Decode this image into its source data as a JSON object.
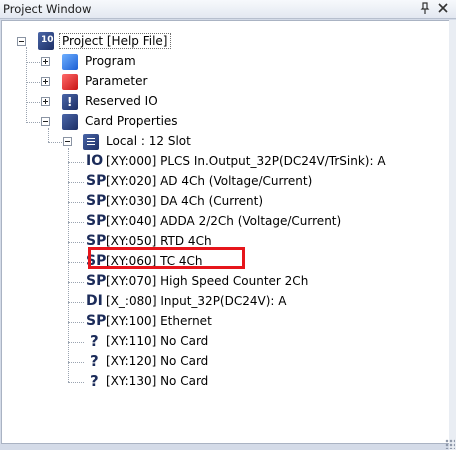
{
  "window": {
    "title": "Project Window",
    "pin_icon": "pin-icon",
    "close_icon": "close-icon"
  },
  "tree": {
    "root": {
      "label": "Project [Help File]",
      "icon": "project-icon"
    },
    "nodes": [
      {
        "label": "Program",
        "icon": "program-icon"
      },
      {
        "label": "Parameter",
        "icon": "parameter-icon"
      },
      {
        "label": "Reserved IO",
        "icon": "reserved-io-icon"
      },
      {
        "label": "Card Properties",
        "icon": "card-properties-icon"
      }
    ],
    "local": {
      "label": "Local : 12 Slot",
      "icon": "local-icon"
    },
    "slots": [
      {
        "code": "IO",
        "label": "[XY:000] PLCS In.Output_32P(DC24V/TrSink): A"
      },
      {
        "code": "SP",
        "label": "[XY:020] AD 4Ch (Voltage/Current)"
      },
      {
        "code": "SP",
        "label": "[XY:030] DA 4Ch (Current)"
      },
      {
        "code": "SP",
        "label": "[XY:040] ADDA 2/2Ch (Voltage/Current)"
      },
      {
        "code": "SP",
        "label": "[XY:050] RTD 4Ch"
      },
      {
        "code": "SP",
        "label": "[XY:060] TC 4Ch"
      },
      {
        "code": "SP",
        "label": "[XY:070] High Speed Counter 2Ch"
      },
      {
        "code": "DI",
        "label": "[X_:080] Input_32P(DC24V): A"
      },
      {
        "code": "SP",
        "label": "[XY:100] Ethernet"
      },
      {
        "code": "?",
        "label": "[XY:110] No Card"
      },
      {
        "code": "?",
        "label": "[XY:120] No Card"
      },
      {
        "code": "?",
        "label": "[XY:130] No Card"
      }
    ],
    "highlight_color": "#e6151b"
  }
}
